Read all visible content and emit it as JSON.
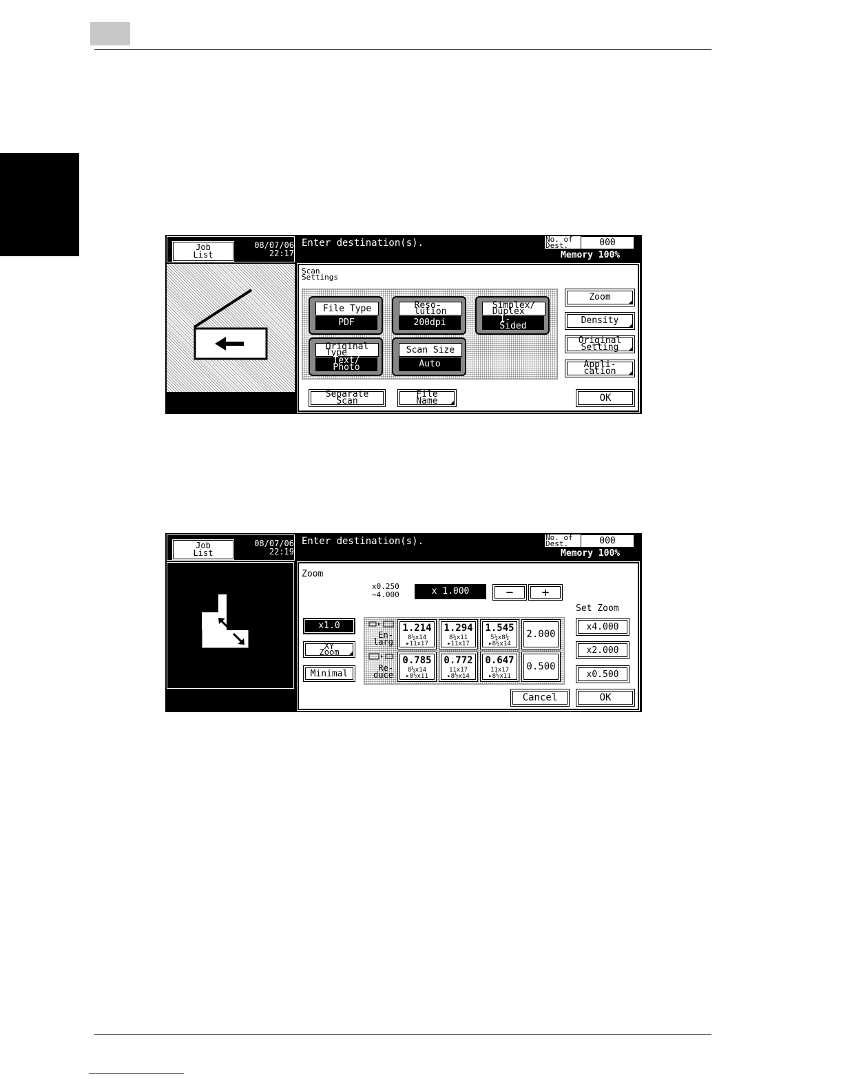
{
  "screen1": {
    "job_list": "Job\nList",
    "datetime": "08/07/06\n22:17",
    "message": "Enter destination(s).",
    "dest_label": "No. of\nDest.",
    "dest_count": "000",
    "memory": "Memory 100%",
    "section_title": "Scan\nSettings",
    "settings": [
      {
        "label": "File Type",
        "value": "PDF"
      },
      {
        "label": "Reso-\nlution",
        "value": "200dpi"
      },
      {
        "label": "Simplex/\nDuplex",
        "value": "1-\nSided"
      },
      {
        "label": "Original\nType",
        "value": "Text/\nPhoto"
      },
      {
        "label": "Scan Size",
        "value": "Auto"
      }
    ],
    "side_buttons": [
      "Zoom",
      "Density",
      "Original\nSetting",
      "Appli-\ncation"
    ],
    "separate_scan": "Separate\nScan",
    "file_name": "File\nName",
    "ok": "OK"
  },
  "screen2": {
    "job_list": "Job\nList",
    "datetime": "08/07/06\n22:19",
    "message": "Enter destination(s).",
    "dest_label": "No. of\nDest.",
    "dest_count": "000",
    "memory": "Memory 100%",
    "title": "Zoom",
    "range": "x0.250\n~4.000",
    "current_zoom": "x 1.000",
    "minus": "−",
    "plus": "+",
    "x10": "x1.0",
    "xy_zoom": "XY\nZoom",
    "minimal": "Minimal",
    "enlarge_label": "En-\nlarg",
    "reduce_label": "Re-\nduce",
    "enlarge": [
      {
        "value": "1.214",
        "from": "8½x14",
        "to": "▸11x17"
      },
      {
        "value": "1.294",
        "from": "8½x11",
        "to": "▸11x17"
      },
      {
        "value": "1.545",
        "from": "5½x8½",
        "to": "▸8½x14"
      }
    ],
    "enlarge_fixed": "2.000",
    "reduce": [
      {
        "value": "0.785",
        "from": "8½x14",
        "to": "▸8½x11"
      },
      {
        "value": "0.772",
        "from": "11x17",
        "to": "▸8½x14"
      },
      {
        "value": "0.647",
        "from": "11x17",
        "to": "▸8½x11"
      }
    ],
    "reduce_fixed": "0.500",
    "set_zoom_title": "Set Zoom",
    "set_zoom": [
      "x4.000",
      "x2.000",
      "x0.500"
    ],
    "cancel": "Cancel",
    "ok": "OK"
  }
}
